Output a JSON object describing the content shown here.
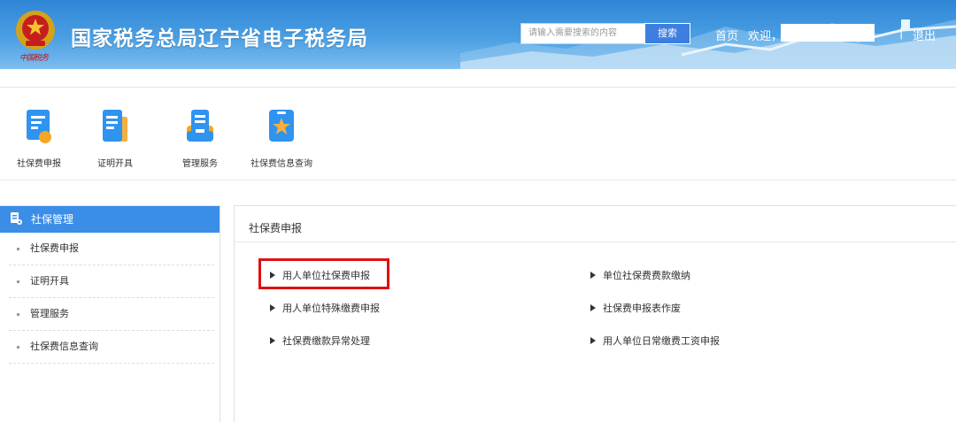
{
  "header": {
    "site_title": "国家税务总局辽宁省电子税务局",
    "emblem_script": "中国税务",
    "search_placeholder": "请输入需要搜索的内容",
    "search_button": "搜索",
    "home": "首页",
    "welcome": "欢迎，",
    "separator": "|",
    "logout": "退出"
  },
  "quick_links": [
    {
      "label": "社保费申报",
      "icon": "declaration-icon"
    },
    {
      "label": "证明开具",
      "icon": "certificate-icon"
    },
    {
      "label": "管理服务",
      "icon": "management-icon"
    },
    {
      "label": "社保费信息查询",
      "icon": "star-badge-icon"
    }
  ],
  "sidebar": {
    "title": "社保管理",
    "items": [
      {
        "label": "社保费申报"
      },
      {
        "label": "证明开具"
      },
      {
        "label": "管理服务"
      },
      {
        "label": "社保费信息查询"
      }
    ]
  },
  "main": {
    "title": "社保费申报",
    "links": [
      {
        "label": "用人单位社保费申报"
      },
      {
        "label": "单位社保费费款缴纳"
      },
      {
        "label": "用人单位特殊缴费申报"
      },
      {
        "label": "社保费申报表作废"
      },
      {
        "label": "社保费缴款异常处理"
      },
      {
        "label": "用人单位日常缴费工资申报"
      }
    ]
  },
  "colors": {
    "header_blue": "#2f86d6",
    "sidebar_head": "#3b8ee8",
    "highlight": "#e01010"
  }
}
